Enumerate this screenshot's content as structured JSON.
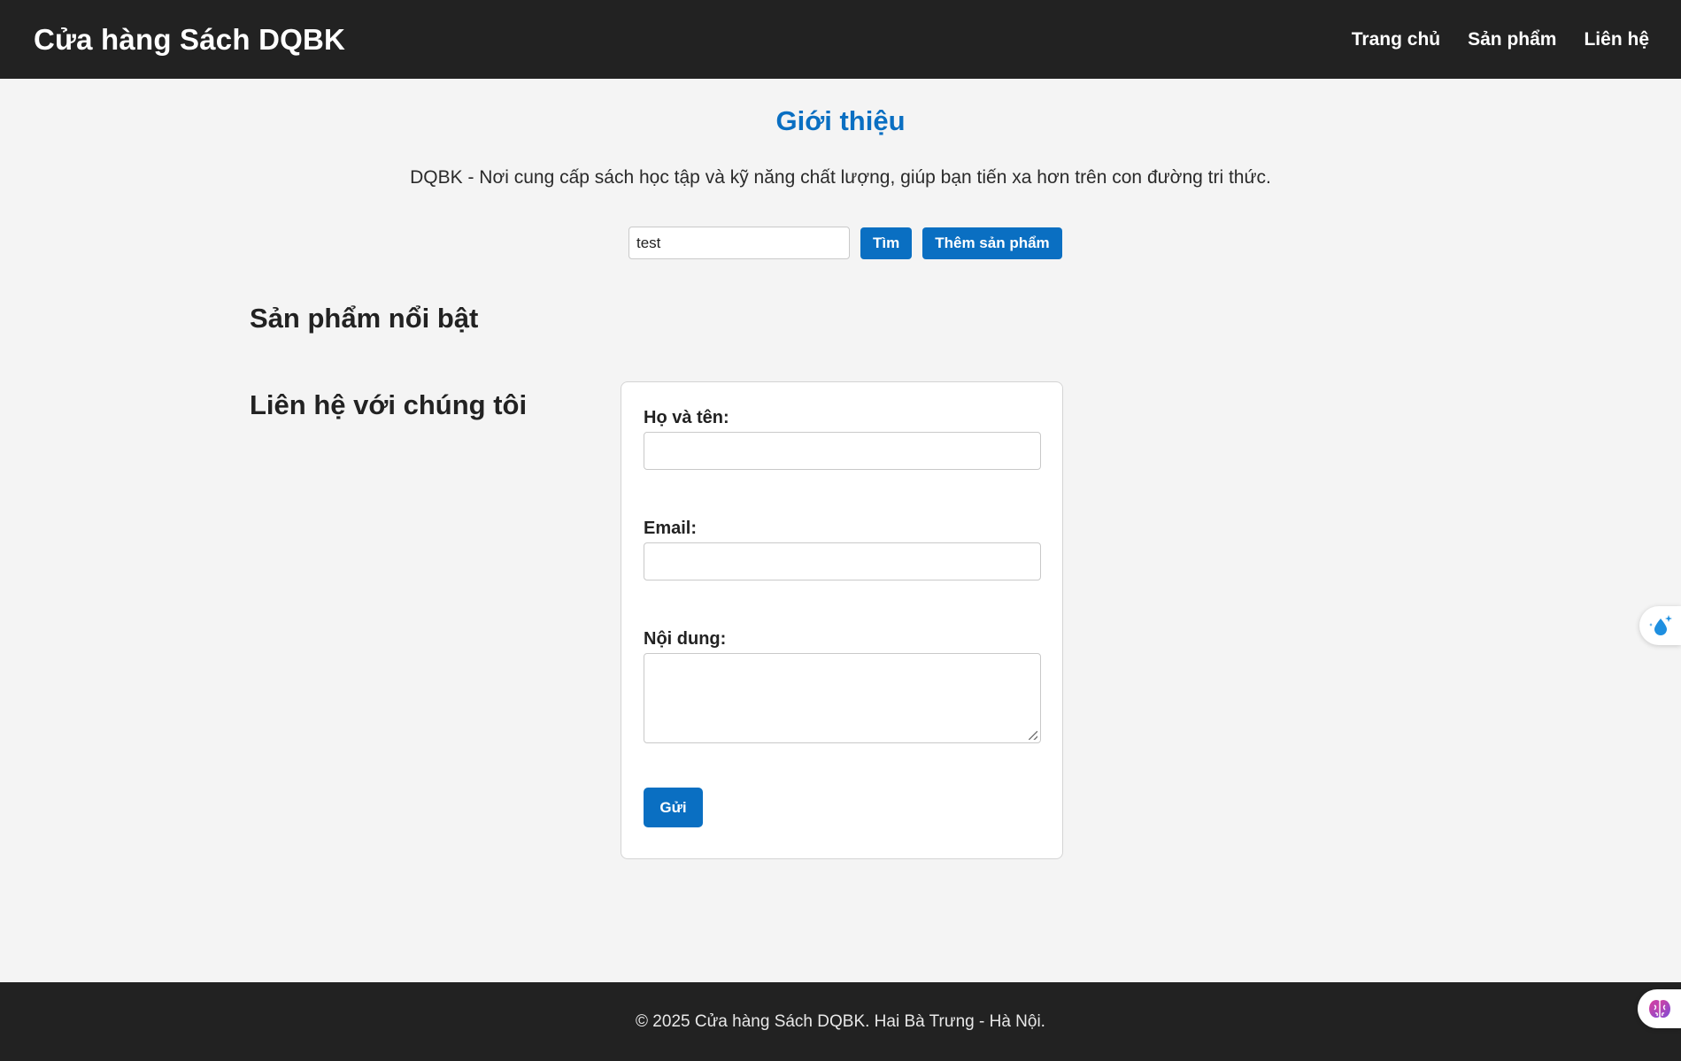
{
  "header": {
    "site_title": "Cửa hàng Sách DQBK",
    "nav": [
      {
        "label": "Trang chủ"
      },
      {
        "label": "Sản phẩm"
      },
      {
        "label": "Liên hệ"
      }
    ]
  },
  "intro": {
    "title": "Giới thiệu",
    "text": "DQBK - Nơi cung cấp sách học tập và kỹ năng chất lượng, giúp bạn tiến xa hơn trên con đường tri thức."
  },
  "search": {
    "value": "test",
    "search_button": "Tìm",
    "add_product_button": "Thêm sản phẩm"
  },
  "featured": {
    "heading": "Sản phẩm nổi bật"
  },
  "contact": {
    "heading": "Liên hệ với chúng tôi",
    "name_label": "Họ và tên:",
    "name_value": "",
    "email_label": "Email:",
    "email_value": "",
    "message_label": "Nội dung:",
    "message_value": "",
    "submit_label": "Gửi"
  },
  "footer": {
    "text": "© 2025 Cửa hàng Sách DQBK. Hai Bà Trưng - Hà Nội."
  },
  "floating_widgets": [
    {
      "icon": "water-drop-sparkle-icon"
    },
    {
      "icon": "brain-icon"
    }
  ],
  "colors": {
    "header_bg": "#222222",
    "accent": "#0a6fc2",
    "page_bg": "#f4f4f4"
  }
}
